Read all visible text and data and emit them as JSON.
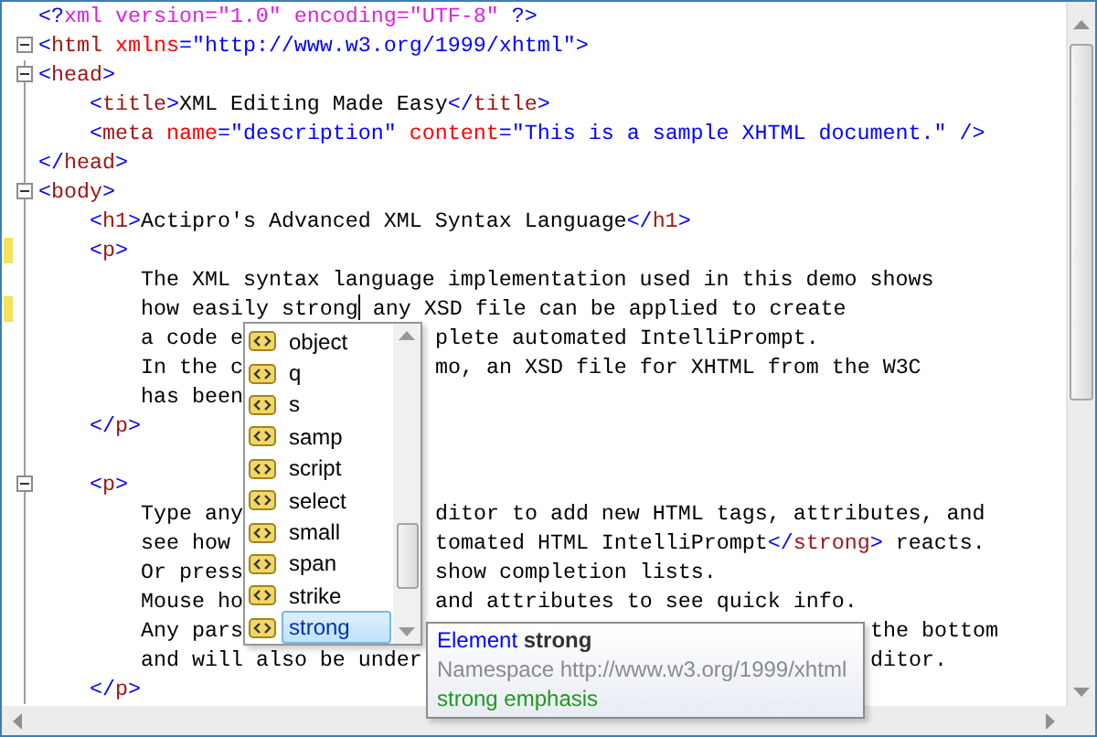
{
  "editor": {
    "lines": [
      {
        "fold": false,
        "changed": false,
        "segments": [
          {
            "tokens": [
              {
                "kind": "delim",
                "text": "<?"
              },
              {
                "kind": "pi",
                "text": "xml version=\"1.0\" encoding=\"UTF-8\" "
              },
              {
                "kind": "delim",
                "text": "?>"
              }
            ]
          }
        ]
      },
      {
        "fold": true,
        "changed": false,
        "segments": [
          {
            "tokens": [
              {
                "kind": "delim",
                "text": "<"
              },
              {
                "kind": "tag",
                "text": "html"
              },
              {
                "kind": "attr",
                "text": " xmlns"
              },
              {
                "kind": "delim",
                "text": "="
              },
              {
                "kind": "value",
                "text": "\"http://www.w3.org/1999/xhtml\""
              },
              {
                "kind": "delim",
                "text": ">"
              }
            ]
          }
        ]
      },
      {
        "fold": true,
        "changed": false,
        "segments": [
          {
            "tokens": [
              {
                "kind": "delim",
                "text": "<"
              },
              {
                "kind": "tag",
                "text": "head"
              },
              {
                "kind": "delim",
                "text": ">"
              }
            ]
          }
        ],
        "children": [
          {
            "fold": false,
            "changed": false,
            "segments": [
              {
                "tokens": [
                  {
                    "kind": "delim",
                    "text": "<"
                  },
                  {
                    "kind": "tag",
                    "text": "title"
                  },
                  {
                    "kind": "delim",
                    "text": ">"
                  },
                  {
                    "kind": "text",
                    "text": "XML Editing Made Easy"
                  },
                  {
                    "kind": "delim",
                    "text": "</"
                  },
                  {
                    "kind": "tag",
                    "text": "title"
                  },
                  {
                    "kind": "delim",
                    "text": ">"
                  }
                ]
              }
            ]
          },
          {
            "fold": false,
            "changed": false,
            "segments": [
              {
                "tokens": [
                  {
                    "kind": "delim",
                    "text": "<"
                  },
                  {
                    "kind": "tag",
                    "text": "meta"
                  },
                  {
                    "kind": "attr",
                    "text": " name"
                  },
                  {
                    "kind": "delim",
                    "text": "="
                  },
                  {
                    "kind": "value",
                    "text": "\"description\""
                  },
                  {
                    "kind": "attr",
                    "text": " content"
                  },
                  {
                    "kind": "delim",
                    "text": "="
                  },
                  {
                    "kind": "value",
                    "text": "\"This is a sample XHTML document.\""
                  },
                  {
                    "kind": "delim",
                    "text": " />"
                  }
                ]
              }
            ]
          }
        ]
      },
      {
        "fold": false,
        "changed": false,
        "segments": [
          {
            "tokens": [
              {
                "kind": "delim",
                "text": "</"
              },
              {
                "kind": "tag",
                "text": "head"
              },
              {
                "kind": "delim",
                "text": ">"
              }
            ]
          }
        ]
      },
      {
        "fold": true,
        "changed": false,
        "segments": [
          {
            "tokens": [
              {
                "kind": "delim",
                "text": "<"
              },
              {
                "kind": "tag",
                "text": "body"
              },
              {
                "kind": "delim",
                "text": ">"
              }
            ]
          }
        ],
        "children": [
          {
            "fold": false,
            "changed": false,
            "segments": [
              {
                "tokens": [
                  {
                    "kind": "delim",
                    "text": "<"
                  },
                  {
                    "kind": "tag",
                    "text": "h1"
                  },
                  {
                    "kind": "delim",
                    "text": ">"
                  },
                  {
                    "kind": "text",
                    "text": "Actipro's Advanced XML Syntax Language"
                  },
                  {
                    "kind": "delim",
                    "text": "</"
                  },
                  {
                    "kind": "tag",
                    "text": "h1"
                  },
                  {
                    "kind": "delim",
                    "text": ">"
                  }
                ]
              }
            ]
          },
          {
            "fold": false,
            "changed": true,
            "segments": [
              {
                "tokens": [
                  {
                    "kind": "delim",
                    "text": "<"
                  },
                  {
                    "kind": "tag",
                    "text": "p"
                  },
                  {
                    "kind": "delim",
                    "text": ">"
                  }
                ]
              }
            ],
            "children": [
              {
                "fold": false,
                "changed": false,
                "segments": [
                  {
                    "tokens": [
                      {
                        "kind": "text",
                        "text": "The XML syntax language implementation used in this demo shows"
                      }
                    ]
                  }
                ]
              },
              {
                "fold": false,
                "changed": true,
                "segments": [
                  {
                    "tokens": [
                      {
                        "kind": "text",
                        "text": "how easily strong"
                      },
                      {
                        "kind": "caret"
                      },
                      {
                        "kind": "text",
                        "text": " any XSD file can be applied to create"
                      }
                    ]
                  }
                ]
              },
              {
                "fold": false,
                "changed": false,
                "segments": [
                  {
                    "kind": "lead",
                    "tokens": [
                      {
                        "kind": "text",
                        "text": "a code e"
                      }
                    ]
                  },
                  {
                    "kind": "after_popup",
                    "tokens": [
                      {
                        "kind": "text",
                        "text": "plete automated IntelliPrompt."
                      }
                    ]
                  }
                ]
              },
              {
                "fold": false,
                "changed": false,
                "segments": [
                  {
                    "kind": "lead",
                    "tokens": [
                      {
                        "kind": "text",
                        "text": "In the c"
                      }
                    ]
                  },
                  {
                    "kind": "after_popup",
                    "tokens": [
                      {
                        "kind": "text",
                        "text": "mo, an XSD file for XHTML from the W3C"
                      }
                    ]
                  }
                ]
              },
              {
                "fold": false,
                "changed": false,
                "segments": [
                  {
                    "tokens": [
                      {
                        "kind": "text",
                        "text": "has been"
                      }
                    ]
                  }
                ]
              }
            ]
          },
          {
            "fold": false,
            "changed": false,
            "segments": [
              {
                "tokens": [
                  {
                    "kind": "delim",
                    "text": "</"
                  },
                  {
                    "kind": "tag",
                    "text": "p"
                  },
                  {
                    "kind": "delim",
                    "text": ">"
                  }
                ]
              }
            ]
          },
          {
            "fold": false,
            "changed": false
          },
          {
            "fold": true,
            "changed": false,
            "segments": [
              {
                "tokens": [
                  {
                    "kind": "delim",
                    "text": "<"
                  },
                  {
                    "kind": "tag",
                    "text": "p"
                  },
                  {
                    "kind": "delim",
                    "text": ">"
                  }
                ]
              }
            ],
            "children": [
              {
                "fold": false,
                "changed": false,
                "segments": [
                  {
                    "kind": "lead",
                    "tokens": [
                      {
                        "kind": "text",
                        "text": "Type any"
                      }
                    ]
                  },
                  {
                    "kind": "after_popup",
                    "tokens": [
                      {
                        "kind": "text",
                        "text": "ditor to add new HTML tags, attributes, and"
                      }
                    ]
                  }
                ]
              },
              {
                "fold": false,
                "changed": false,
                "segments": [
                  {
                    "kind": "lead",
                    "tokens": [
                      {
                        "kind": "text",
                        "text": "see how"
                      }
                    ]
                  },
                  {
                    "kind": "after_popup",
                    "tokens": [
                      {
                        "kind": "text",
                        "text": "tomated HTML IntelliPrompt"
                      },
                      {
                        "kind": "delim",
                        "text": "</"
                      },
                      {
                        "kind": "tag",
                        "text": "strong"
                      },
                      {
                        "kind": "delim",
                        "text": ">"
                      },
                      {
                        "kind": "text",
                        "text": " reacts."
                      }
                    ]
                  }
                ]
              },
              {
                "fold": false,
                "changed": false,
                "segments": [
                  {
                    "kind": "lead",
                    "tokens": [
                      {
                        "kind": "text",
                        "text": "Or press"
                      }
                    ]
                  },
                  {
                    "kind": "after_popup",
                    "tokens": [
                      {
                        "kind": "text",
                        "text": "show completion lists."
                      }
                    ]
                  }
                ]
              },
              {
                "fold": false,
                "changed": false,
                "segments": [
                  {
                    "kind": "lead",
                    "tokens": [
                      {
                        "kind": "text",
                        "text": "Mouse ho"
                      }
                    ]
                  },
                  {
                    "kind": "after_popup",
                    "tokens": [
                      {
                        "kind": "text",
                        "text": "and attributes to see quick info."
                      }
                    ]
                  }
                ]
              },
              {
                "fold": false,
                "changed": false,
                "segments": [
                  {
                    "kind": "lead",
                    "tokens": [
                      {
                        "kind": "text",
                        "text": "Any pars"
                      }
                    ]
                  },
                  {
                    "kind": "after_tooltip",
                    "tokens": [
                      {
                        "kind": "text",
                        "text": "the bottom"
                      }
                    ]
                  }
                ]
              },
              {
                "fold": false,
                "changed": false,
                "segments": [
                  {
                    "kind": "lead",
                    "tokens": [
                      {
                        "kind": "text",
                        "text": "and will also be under"
                      }
                    ]
                  },
                  {
                    "kind": "after_tooltip",
                    "tokens": [
                      {
                        "kind": "text",
                        "text": "ditor."
                      }
                    ]
                  }
                ]
              }
            ]
          },
          {
            "fold": false,
            "changed": false,
            "segments": [
              {
                "tokens": [
                  {
                    "kind": "delim",
                    "text": "</"
                  },
                  {
                    "kind": "tag",
                    "text": "p"
                  },
                  {
                    "kind": "delim",
                    "text": ">"
                  }
                ]
              }
            ]
          }
        ]
      }
    ]
  },
  "completion_list": {
    "items": [
      {
        "label": "object",
        "selected": false
      },
      {
        "label": "q",
        "selected": false
      },
      {
        "label": "s",
        "selected": false
      },
      {
        "label": "samp",
        "selected": false
      },
      {
        "label": "script",
        "selected": false
      },
      {
        "label": "select",
        "selected": false
      },
      {
        "label": "small",
        "selected": false
      },
      {
        "label": "span",
        "selected": false
      },
      {
        "label": "strike",
        "selected": false
      },
      {
        "label": "strong",
        "selected": true
      }
    ]
  },
  "quick_info": {
    "kind_label": "Element",
    "name": "strong",
    "namespace": "Namespace http://www.w3.org/1999/xhtml",
    "description": "strong emphasis"
  }
}
